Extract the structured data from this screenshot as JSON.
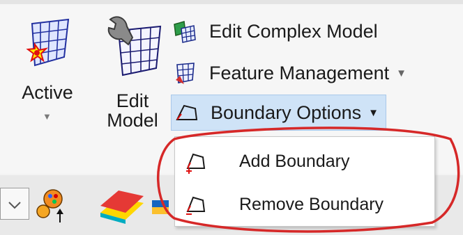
{
  "ribbon": {
    "active": {
      "label": "Active",
      "icon": "active-surface-icon"
    },
    "edit_model": {
      "label_line1": "Edit",
      "label_line2": "Model",
      "icon": "edit-model-icon"
    },
    "edit_complex_model": {
      "label": "Edit Complex Model",
      "icon": "complex-model-icon"
    },
    "feature_management": {
      "label": "Feature Management",
      "icon": "feature-management-icon"
    },
    "boundary_options": {
      "label": "Boundary Options",
      "icon": "boundary-icon",
      "selected": true
    }
  },
  "dropdown": {
    "items": [
      {
        "label": "Add Boundary",
        "icon": "add-boundary-icon"
      },
      {
        "label": "Remove Boundary",
        "icon": "remove-boundary-icon"
      }
    ]
  },
  "colors": {
    "highlight": "#cfe3f7",
    "annotation": "#d62828",
    "ribbon_bg": "#f6f6f6"
  }
}
